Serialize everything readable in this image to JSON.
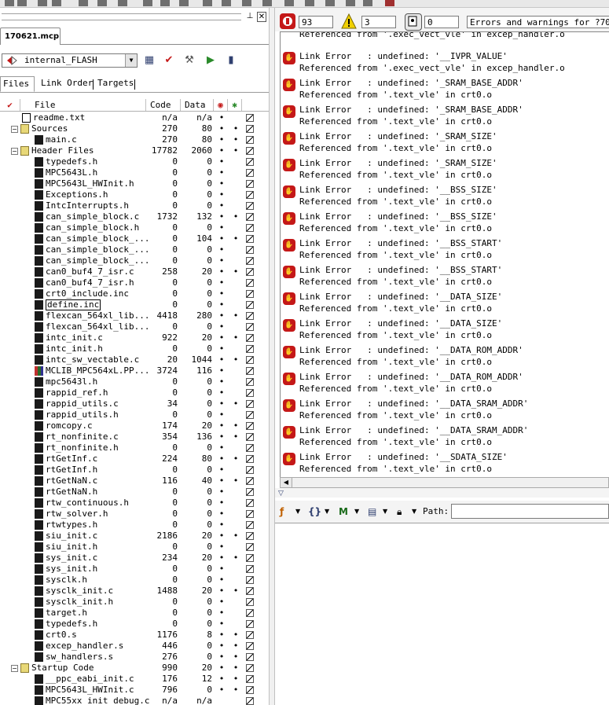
{
  "project_tab": "170621.mcp",
  "target": "internal_FLASH",
  "subtabs": [
    "Files",
    "Link Order",
    "Targets"
  ],
  "columns": {
    "file": "File",
    "code": "Code",
    "data": "Data"
  },
  "files": [
    {
      "indent": 0,
      "kind": "txt",
      "tw": "",
      "name": "readme.txt",
      "code": "n/a",
      "data": "n/a",
      "d1": "•",
      "d2": "",
      "act": true
    },
    {
      "indent": 0,
      "kind": "folder",
      "tw": "−",
      "name": "Sources",
      "code": "270",
      "data": "80",
      "d1": "•",
      "d2": "•",
      "act": true
    },
    {
      "indent": 1,
      "kind": "file",
      "tw": "",
      "name": "main.c",
      "code": "270",
      "data": "80",
      "d1": "•",
      "d2": "•",
      "act": true
    },
    {
      "indent": 0,
      "kind": "folder",
      "tw": "−",
      "name": "Header Files",
      "code": "17782",
      "data": "2060",
      "d1": "•",
      "d2": "•",
      "act": true
    },
    {
      "indent": 1,
      "kind": "file",
      "tw": "",
      "name": "typedefs.h",
      "code": "0",
      "data": "0",
      "d1": "•",
      "d2": "",
      "act": true
    },
    {
      "indent": 1,
      "kind": "file",
      "tw": "",
      "name": "MPC5643L.h",
      "code": "0",
      "data": "0",
      "d1": "•",
      "d2": "",
      "act": true
    },
    {
      "indent": 1,
      "kind": "file",
      "tw": "",
      "name": "MPC5643L_HWInit.h",
      "code": "0",
      "data": "0",
      "d1": "•",
      "d2": "",
      "act": true
    },
    {
      "indent": 1,
      "kind": "file",
      "tw": "",
      "name": "Exceptions.h",
      "code": "0",
      "data": "0",
      "d1": "•",
      "d2": "",
      "act": true
    },
    {
      "indent": 1,
      "kind": "file",
      "tw": "",
      "name": "IntcInterrupts.h",
      "code": "0",
      "data": "0",
      "d1": "•",
      "d2": "",
      "act": true
    },
    {
      "indent": 1,
      "kind": "file",
      "tw": "",
      "name": "can_simple_block.c",
      "code": "1732",
      "data": "132",
      "d1": "•",
      "d2": "•",
      "act": true
    },
    {
      "indent": 1,
      "kind": "file",
      "tw": "",
      "name": "can_simple_block.h",
      "code": "0",
      "data": "0",
      "d1": "•",
      "d2": "",
      "act": true
    },
    {
      "indent": 1,
      "kind": "file",
      "tw": "",
      "name": "can_simple_block_...",
      "code": "0",
      "data": "104",
      "d1": "•",
      "d2": "•",
      "act": true
    },
    {
      "indent": 1,
      "kind": "file",
      "tw": "",
      "name": "can_simple_block_...",
      "code": "0",
      "data": "0",
      "d1": "•",
      "d2": "",
      "act": true
    },
    {
      "indent": 1,
      "kind": "file",
      "tw": "",
      "name": "can_simple_block_...",
      "code": "0",
      "data": "0",
      "d1": "•",
      "d2": "",
      "act": true
    },
    {
      "indent": 1,
      "kind": "file",
      "tw": "",
      "name": "can0_buf4_7_isr.c",
      "code": "258",
      "data": "20",
      "d1": "•",
      "d2": "•",
      "act": true
    },
    {
      "indent": 1,
      "kind": "file",
      "tw": "",
      "name": "can0_buf4_7_isr.h",
      "code": "0",
      "data": "0",
      "d1": "•",
      "d2": "",
      "act": true
    },
    {
      "indent": 1,
      "kind": "file",
      "tw": "",
      "name": "crt0_include.inc",
      "code": "0",
      "data": "0",
      "d1": "•",
      "d2": "",
      "act": true
    },
    {
      "indent": 1,
      "kind": "file",
      "tw": "",
      "name": "define.inc",
      "code": "0",
      "data": "0",
      "d1": "•",
      "d2": "",
      "act": true,
      "selected": true
    },
    {
      "indent": 1,
      "kind": "file",
      "tw": "",
      "name": "flexcan_564xl_lib...",
      "code": "4418",
      "data": "280",
      "d1": "•",
      "d2": "•",
      "act": true
    },
    {
      "indent": 1,
      "kind": "file",
      "tw": "",
      "name": "flexcan_564xl_lib...",
      "code": "0",
      "data": "0",
      "d1": "•",
      "d2": "",
      "act": true
    },
    {
      "indent": 1,
      "kind": "file",
      "tw": "",
      "name": "intc_init.c",
      "code": "922",
      "data": "20",
      "d1": "•",
      "d2": "•",
      "act": true
    },
    {
      "indent": 1,
      "kind": "file",
      "tw": "",
      "name": "intc_init.h",
      "code": "0",
      "data": "0",
      "d1": "•",
      "d2": "",
      "act": true
    },
    {
      "indent": 1,
      "kind": "file",
      "tw": "",
      "name": "intc_sw_vectable.c",
      "code": "20",
      "data": "1044",
      "d1": "•",
      "d2": "•",
      "act": true
    },
    {
      "indent": 1,
      "kind": "lib",
      "tw": "",
      "name": "MCLIB_MPC564xL.PP...",
      "code": "3724",
      "data": "116",
      "d1": "•",
      "d2": "",
      "act": true
    },
    {
      "indent": 1,
      "kind": "file",
      "tw": "",
      "name": "mpc5643l.h",
      "code": "0",
      "data": "0",
      "d1": "•",
      "d2": "",
      "act": true
    },
    {
      "indent": 1,
      "kind": "file",
      "tw": "",
      "name": "rappid_ref.h",
      "code": "0",
      "data": "0",
      "d1": "•",
      "d2": "",
      "act": true
    },
    {
      "indent": 1,
      "kind": "file",
      "tw": "",
      "name": "rappid_utils.c",
      "code": "34",
      "data": "0",
      "d1": "•",
      "d2": "•",
      "act": true
    },
    {
      "indent": 1,
      "kind": "file",
      "tw": "",
      "name": "rappid_utils.h",
      "code": "0",
      "data": "0",
      "d1": "•",
      "d2": "",
      "act": true
    },
    {
      "indent": 1,
      "kind": "file",
      "tw": "",
      "name": "romcopy.c",
      "code": "174",
      "data": "20",
      "d1": "•",
      "d2": "•",
      "act": true
    },
    {
      "indent": 1,
      "kind": "file",
      "tw": "",
      "name": "rt_nonfinite.c",
      "code": "354",
      "data": "136",
      "d1": "•",
      "d2": "•",
      "act": true
    },
    {
      "indent": 1,
      "kind": "file",
      "tw": "",
      "name": "rt_nonfinite.h",
      "code": "0",
      "data": "0",
      "d1": "•",
      "d2": "",
      "act": true
    },
    {
      "indent": 1,
      "kind": "file",
      "tw": "",
      "name": "rtGetInf.c",
      "code": "224",
      "data": "80",
      "d1": "•",
      "d2": "•",
      "act": true
    },
    {
      "indent": 1,
      "kind": "file",
      "tw": "",
      "name": "rtGetInf.h",
      "code": "0",
      "data": "0",
      "d1": "•",
      "d2": "",
      "act": true
    },
    {
      "indent": 1,
      "kind": "file",
      "tw": "",
      "name": "rtGetNaN.c",
      "code": "116",
      "data": "40",
      "d1": "•",
      "d2": "•",
      "act": true
    },
    {
      "indent": 1,
      "kind": "file",
      "tw": "",
      "name": "rtGetNaN.h",
      "code": "0",
      "data": "0",
      "d1": "•",
      "d2": "",
      "act": true
    },
    {
      "indent": 1,
      "kind": "file",
      "tw": "",
      "name": "rtw_continuous.h",
      "code": "0",
      "data": "0",
      "d1": "•",
      "d2": "",
      "act": true
    },
    {
      "indent": 1,
      "kind": "file",
      "tw": "",
      "name": "rtw_solver.h",
      "code": "0",
      "data": "0",
      "d1": "•",
      "d2": "",
      "act": true
    },
    {
      "indent": 1,
      "kind": "file",
      "tw": "",
      "name": "rtwtypes.h",
      "code": "0",
      "data": "0",
      "d1": "•",
      "d2": "",
      "act": true
    },
    {
      "indent": 1,
      "kind": "file",
      "tw": "",
      "name": "siu_init.c",
      "code": "2186",
      "data": "20",
      "d1": "•",
      "d2": "•",
      "act": true
    },
    {
      "indent": 1,
      "kind": "file",
      "tw": "",
      "name": "siu_init.h",
      "code": "0",
      "data": "0",
      "d1": "•",
      "d2": "",
      "act": true
    },
    {
      "indent": 1,
      "kind": "file",
      "tw": "",
      "name": "sys_init.c",
      "code": "234",
      "data": "20",
      "d1": "•",
      "d2": "•",
      "act": true
    },
    {
      "indent": 1,
      "kind": "file",
      "tw": "",
      "name": "sys_init.h",
      "code": "0",
      "data": "0",
      "d1": "•",
      "d2": "",
      "act": true
    },
    {
      "indent": 1,
      "kind": "file",
      "tw": "",
      "name": "sysclk.h",
      "code": "0",
      "data": "0",
      "d1": "•",
      "d2": "",
      "act": true
    },
    {
      "indent": 1,
      "kind": "file",
      "tw": "",
      "name": "sysclk_init.c",
      "code": "1488",
      "data": "20",
      "d1": "•",
      "d2": "•",
      "act": true
    },
    {
      "indent": 1,
      "kind": "file",
      "tw": "",
      "name": "sysclk_init.h",
      "code": "0",
      "data": "0",
      "d1": "•",
      "d2": "",
      "act": true
    },
    {
      "indent": 1,
      "kind": "file",
      "tw": "",
      "name": "target.h",
      "code": "0",
      "data": "0",
      "d1": "•",
      "d2": "",
      "act": true
    },
    {
      "indent": 1,
      "kind": "file",
      "tw": "",
      "name": "typedefs.h",
      "code": "0",
      "data": "0",
      "d1": "•",
      "d2": "",
      "act": true
    },
    {
      "indent": 1,
      "kind": "file",
      "tw": "",
      "name": "crt0.s",
      "code": "1176",
      "data": "8",
      "d1": "•",
      "d2": "•",
      "act": true
    },
    {
      "indent": 1,
      "kind": "file",
      "tw": "",
      "name": "excep_handler.s",
      "code": "446",
      "data": "0",
      "d1": "•",
      "d2": "•",
      "act": true
    },
    {
      "indent": 1,
      "kind": "file",
      "tw": "",
      "name": "sw_handlers.s",
      "code": "276",
      "data": "0",
      "d1": "•",
      "d2": "•",
      "act": true
    },
    {
      "indent": 0,
      "kind": "folder",
      "tw": "−",
      "name": "Startup Code",
      "code": "990",
      "data": "20",
      "d1": "•",
      "d2": "•",
      "act": true
    },
    {
      "indent": 1,
      "kind": "file",
      "tw": "",
      "name": "__ppc_eabi_init.c",
      "code": "176",
      "data": "12",
      "d1": "•",
      "d2": "•",
      "act": true
    },
    {
      "indent": 1,
      "kind": "file",
      "tw": "",
      "name": "MPC5643L_HWInit.c",
      "code": "796",
      "data": "0",
      "d1": "•",
      "d2": "•",
      "act": true
    },
    {
      "indent": 1,
      "kind": "file",
      "tw": "",
      "name": "MPC55xx_init_debug.c",
      "code": "n/a",
      "data": "n/a",
      "d1": "",
      "d2": "",
      "act": true
    }
  ],
  "errors_panel": {
    "error_count": "93",
    "warning_count": "3",
    "info_count": "0",
    "title": "Errors and warnings for ?70621"
  },
  "messages": [
    {
      "l1": "Link Error   : undefined: '__IVPR_VALUE'",
      "l2": "Referenced from '.exec_vect_vle' in excep_handler.o"
    },
    {
      "l1": "Link Error   : undefined: '_SRAM_BASE_ADDR'",
      "l2": "Referenced from '.text_vle' in crt0.o"
    },
    {
      "l1": "Link Error   : undefined: '_SRAM_BASE_ADDR'",
      "l2": "Referenced from '.text_vle' in crt0.o"
    },
    {
      "l1": "Link Error   : undefined: '_SRAM_SIZE'",
      "l2": "Referenced from '.text_vle' in crt0.o"
    },
    {
      "l1": "Link Error   : undefined: '_SRAM_SIZE'",
      "l2": "Referenced from '.text_vle' in crt0.o"
    },
    {
      "l1": "Link Error   : undefined: '__BSS_SIZE'",
      "l2": "Referenced from '.text_vle' in crt0.o"
    },
    {
      "l1": "Link Error   : undefined: '__BSS_SIZE'",
      "l2": "Referenced from '.text_vle' in crt0.o"
    },
    {
      "l1": "Link Error   : undefined: '__BSS_START'",
      "l2": "Referenced from '.text_vle' in crt0.o"
    },
    {
      "l1": "Link Error   : undefined: '__BSS_START'",
      "l2": "Referenced from '.text_vle' in crt0.o"
    },
    {
      "l1": "Link Error   : undefined: '__DATA_SIZE'",
      "l2": "Referenced from '.text_vle' in crt0.o"
    },
    {
      "l1": "Link Error   : undefined: '__DATA_SIZE'",
      "l2": "Referenced from '.text_vle' in crt0.o"
    },
    {
      "l1": "Link Error   : undefined: '__DATA_ROM_ADDR'",
      "l2": "Referenced from '.text_vle' in crt0.o"
    },
    {
      "l1": "Link Error   : undefined: '__DATA_ROM_ADDR'",
      "l2": "Referenced from '.text_vle' in crt0.o"
    },
    {
      "l1": "Link Error   : undefined: '__DATA_SRAM_ADDR'",
      "l2": "Referenced from '.text_vle' in crt0.o"
    },
    {
      "l1": "Link Error   : undefined: '__DATA_SRAM_ADDR'",
      "l2": "Referenced from '.text_vle' in crt0.o"
    },
    {
      "l1": "Link Error   : undefined: '__SDATA_SIZE'",
      "l2": "Referenced from '.text_vle' in crt0.o"
    }
  ],
  "top_partial_line": "Referenced from '.exec_vect_vle' in excep_handler.o",
  "path_label": "Path:",
  "colors": {
    "error_red": "#c41818",
    "warning_yellow": "#f0d000",
    "accent": "#304070"
  },
  "icons": [
    "stop-error-icon",
    "warning-icon",
    "info-icon",
    "function-icon",
    "braces-icon",
    "marker-icon",
    "document-icon",
    "lock-icon"
  ]
}
